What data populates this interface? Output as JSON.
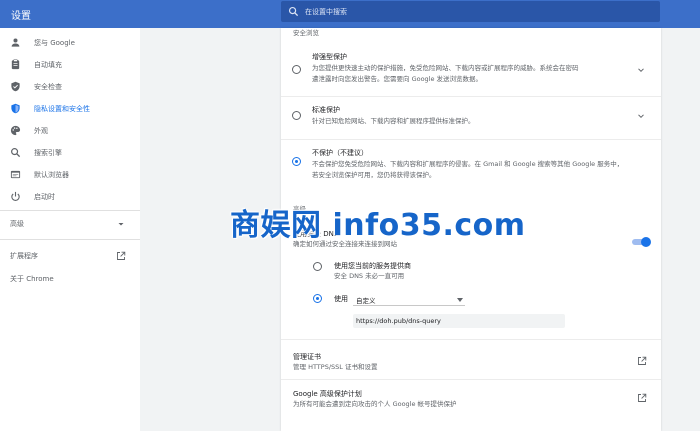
{
  "app": {
    "title": "设置"
  },
  "search": {
    "placeholder": "在设置中搜索"
  },
  "sidebar": {
    "items": [
      {
        "label": "您与 Google",
        "icon": "person-icon"
      },
      {
        "label": "自动填充",
        "icon": "clipboard-icon"
      },
      {
        "label": "安全检查",
        "icon": "shield-check-icon"
      },
      {
        "label": "隐私设置和安全性",
        "icon": "shield-icon",
        "active": true
      },
      {
        "label": "外观",
        "icon": "palette-icon"
      },
      {
        "label": "搜索引擎",
        "icon": "search-icon"
      },
      {
        "label": "默认浏览器",
        "icon": "browser-icon"
      },
      {
        "label": "启动时",
        "icon": "power-icon"
      }
    ],
    "advanced": "高级",
    "extensions": "扩展程序",
    "about": "关于 Chrome"
  },
  "content": {
    "section_label": "安全浏览",
    "enhanced": {
      "title": "增强型保护",
      "desc_1": "为您提供更快速主动的保护措施，免受危险网站、下载内容或扩展程序的威胁。系统会在密码",
      "desc_2": "遭泄露时向您发出警告。您需要向 Google 发送浏览数据。"
    },
    "standard": {
      "title": "标准保护",
      "desc": "针对已知危险网站、下载内容和扩展程序提供标准保护。"
    },
    "none": {
      "title": "不保护（不建议）",
      "desc_1": "不会保护您免受危险网站、下载内容和扩展程序的侵害。在 Gmail 和 Google 搜索等其他 Google 服务中，",
      "desc_2": "若安全浏览保护可用，您仍将获得该保护。"
    },
    "advanced_label": "高级",
    "secure_dns": {
      "title": "使用安全 DNS",
      "desc": "确定如何通过安全连接来连接到网站",
      "enabled": true
    },
    "dns_current": {
      "title": "使用您当前的服务提供商",
      "desc": "安全 DNS 未必一直可用"
    },
    "dns_custom": {
      "label": "使用",
      "select_value": "自定义",
      "input_value": "https://doh.pub/dns-query"
    },
    "certs": {
      "title": "管理证书",
      "desc": "管理 HTTPS/SSL 证书和设置"
    },
    "protection_program": {
      "title": "Google 高级保护计划",
      "desc": "为所有可能会遭到定向攻击的个人 Google 帐号提供保护"
    }
  },
  "watermark": "商娱网 info35.com",
  "colors": {
    "accent": "#1a73e8",
    "topbar": "#3c6fc9",
    "search_bg": "#2a56a8"
  }
}
